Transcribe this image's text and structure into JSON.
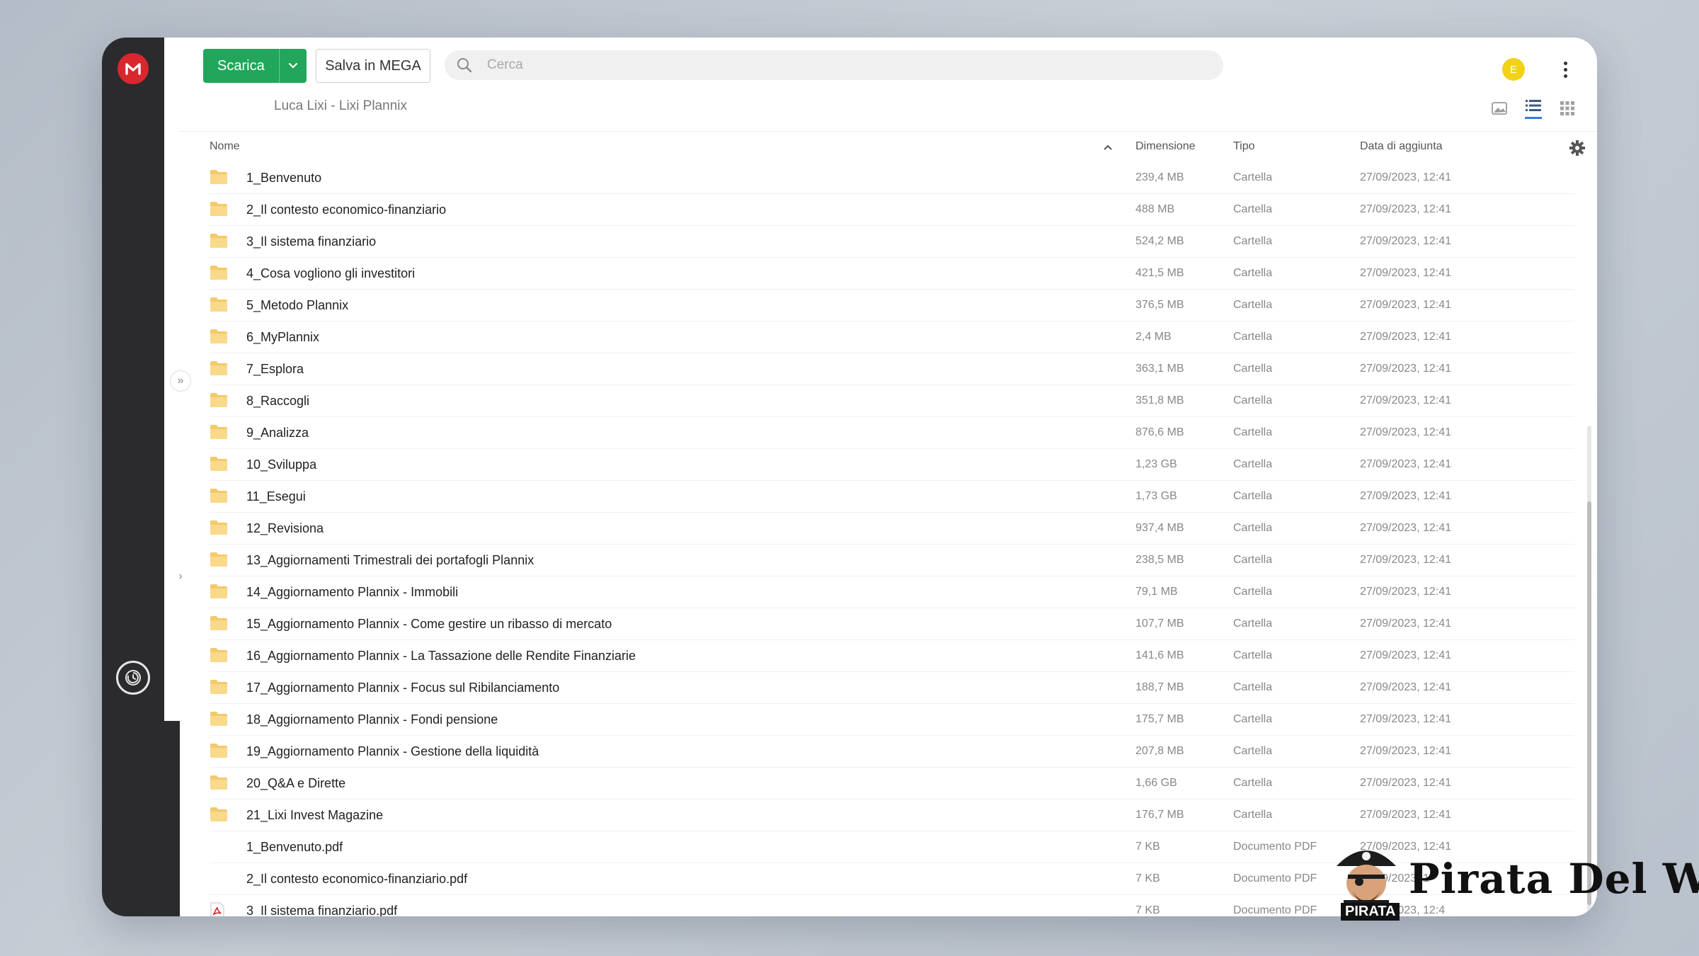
{
  "toolbar": {
    "download_label": "Scarica",
    "save_label": "Salva in MEGA"
  },
  "search": {
    "placeholder": "Cerca"
  },
  "user": {
    "avatar_initial": "E",
    "avatar_color": "#f2d217"
  },
  "breadcrumb": "Luca Lixi - Lixi Plannix",
  "columns": {
    "name": "Nome",
    "size": "Dimensione",
    "type": "Tipo",
    "date": "Data di aggiunta"
  },
  "icons": [
    "mega-logo-icon",
    "search-icon",
    "chevron-down-icon",
    "kebab-menu-icon",
    "thumbnail-view-icon",
    "list-view-icon",
    "grid-view-icon",
    "gear-icon",
    "folder-icon",
    "pdf-icon",
    "sync-icon",
    "expand-icon"
  ],
  "colors": {
    "accent_green": "#21a65b",
    "mega_red": "#d9272e",
    "folder_yellow": "#f5c96a",
    "sidebar": "#2b2b2d"
  },
  "rows": [
    {
      "name": "1_Benvenuto",
      "size": "239,4 MB",
      "type": "Cartella",
      "date": "27/09/2023, 12:41",
      "kind": "folder"
    },
    {
      "name": "2_Il contesto economico-finanziario",
      "size": "488 MB",
      "type": "Cartella",
      "date": "27/09/2023, 12:41",
      "kind": "folder"
    },
    {
      "name": "3_Il sistema finanziario",
      "size": "524,2 MB",
      "type": "Cartella",
      "date": "27/09/2023, 12:41",
      "kind": "folder"
    },
    {
      "name": "4_Cosa vogliono gli investitori",
      "size": "421,5 MB",
      "type": "Cartella",
      "date": "27/09/2023, 12:41",
      "kind": "folder"
    },
    {
      "name": "5_Metodo Plannix",
      "size": "376,5 MB",
      "type": "Cartella",
      "date": "27/09/2023, 12:41",
      "kind": "folder"
    },
    {
      "name": "6_MyPlannix",
      "size": "2,4 MB",
      "type": "Cartella",
      "date": "27/09/2023, 12:41",
      "kind": "folder"
    },
    {
      "name": "7_Esplora",
      "size": "363,1 MB",
      "type": "Cartella",
      "date": "27/09/2023, 12:41",
      "kind": "folder"
    },
    {
      "name": "8_Raccogli",
      "size": "351,8 MB",
      "type": "Cartella",
      "date": "27/09/2023, 12:41",
      "kind": "folder"
    },
    {
      "name": "9_Analizza",
      "size": "876,6 MB",
      "type": "Cartella",
      "date": "27/09/2023, 12:41",
      "kind": "folder"
    },
    {
      "name": "10_Sviluppa",
      "size": "1,23 GB",
      "type": "Cartella",
      "date": "27/09/2023, 12:41",
      "kind": "folder"
    },
    {
      "name": "11_Esegui",
      "size": "1,73 GB",
      "type": "Cartella",
      "date": "27/09/2023, 12:41",
      "kind": "folder"
    },
    {
      "name": "12_Revisiona",
      "size": "937,4 MB",
      "type": "Cartella",
      "date": "27/09/2023, 12:41",
      "kind": "folder"
    },
    {
      "name": "13_Aggiornamenti Trimestrali dei portafogli Plannix",
      "size": "238,5 MB",
      "type": "Cartella",
      "date": "27/09/2023, 12:41",
      "kind": "folder"
    },
    {
      "name": "14_Aggiornamento Plannix - Immobili",
      "size": "79,1 MB",
      "type": "Cartella",
      "date": "27/09/2023, 12:41",
      "kind": "folder"
    },
    {
      "name": "15_Aggiornamento Plannix - Come gestire un ribasso di mercato",
      "size": "107,7 MB",
      "type": "Cartella",
      "date": "27/09/2023, 12:41",
      "kind": "folder"
    },
    {
      "name": "16_Aggiornamento Plannix - La Tassazione delle Rendite Finanziarie",
      "size": "141,6 MB",
      "type": "Cartella",
      "date": "27/09/2023, 12:41",
      "kind": "folder"
    },
    {
      "name": "17_Aggiornamento Plannix - Focus sul Ribilanciamento",
      "size": "188,7 MB",
      "type": "Cartella",
      "date": "27/09/2023, 12:41",
      "kind": "folder"
    },
    {
      "name": "18_Aggiornamento Plannix - Fondi pensione",
      "size": "175,7 MB",
      "type": "Cartella",
      "date": "27/09/2023, 12:41",
      "kind": "folder"
    },
    {
      "name": "19_Aggiornamento Plannix - Gestione della liquidità",
      "size": "207,8 MB",
      "type": "Cartella",
      "date": "27/09/2023, 12:41",
      "kind": "folder"
    },
    {
      "name": "20_Q&A e Dirette",
      "size": "1,66 GB",
      "type": "Cartella",
      "date": "27/09/2023, 12:41",
      "kind": "folder"
    },
    {
      "name": "21_Lixi Invest Magazine",
      "size": "176,7 MB",
      "type": "Cartella",
      "date": "27/09/2023, 12:41",
      "kind": "folder"
    },
    {
      "name": "1_Benvenuto.pdf",
      "size": "7 KB",
      "type": "Documento PDF",
      "date": "27/09/2023, 12:41",
      "kind": "pdf-hidden"
    },
    {
      "name": "2_Il contesto economico-finanziario.pdf",
      "size": "7 KB",
      "type": "Documento PDF",
      "date": "27/09/2023, 1",
      "kind": "pdf-hidden"
    },
    {
      "name": "3_Il sistema finanziario.pdf",
      "size": "7 KB",
      "type": "Documento PDF",
      "date": "27/09/2023, 12:4",
      "kind": "pdf"
    }
  ],
  "watermark": {
    "brand": "Pirata Del Web",
    "badge": "PIRATA"
  }
}
